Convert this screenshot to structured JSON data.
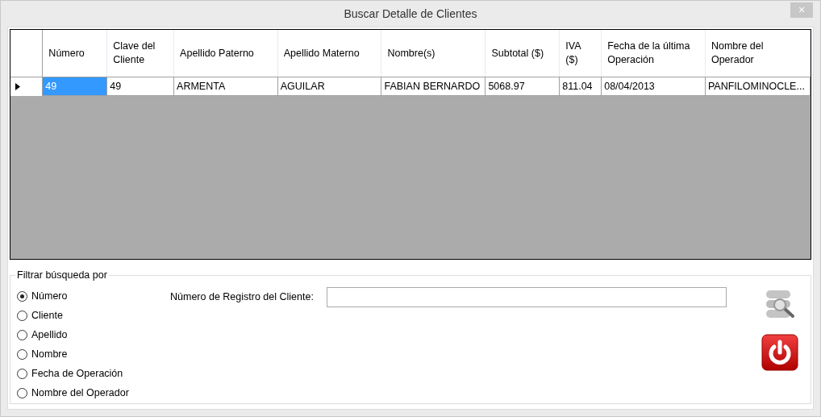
{
  "window": {
    "title": "Buscar Detalle de Clientes",
    "close": "×"
  },
  "table": {
    "columns": [
      "Número",
      "Clave del Cliente",
      "Apellido Paterno",
      "Apellido Materno",
      "Nombre(s)",
      "Subtotal ($)",
      "IVA ($)",
      "Fecha de la última Operación",
      "Nombre del Operador"
    ],
    "rows": [
      {
        "current": true,
        "cells": [
          {
            "text": "49",
            "selected": true
          },
          {
            "text": "49",
            "selected": false
          },
          {
            "text": "ARMENTA",
            "selected": false
          },
          {
            "text": "AGUILAR",
            "selected": false
          },
          {
            "text": "FABIAN BERNARDO",
            "selected": false
          },
          {
            "text": "5068.97",
            "selected": false
          },
          {
            "text": "811.04",
            "selected": false
          },
          {
            "text": "08/04/2013",
            "selected": false
          },
          {
            "text": "PANFILOMINOCLE...",
            "selected": false
          }
        ]
      }
    ]
  },
  "filter": {
    "title": "Filtrar búsqueda por",
    "options": [
      {
        "label": "Número",
        "selected": true
      },
      {
        "label": "Cliente",
        "selected": false
      },
      {
        "label": "Apellido",
        "selected": false
      },
      {
        "label": "Nombre",
        "selected": false
      },
      {
        "label": "Fecha de Operación",
        "selected": false
      },
      {
        "label": "Nombre del Operador",
        "selected": false
      }
    ],
    "field_label": "Número de Registro del Cliente:"
  }
}
